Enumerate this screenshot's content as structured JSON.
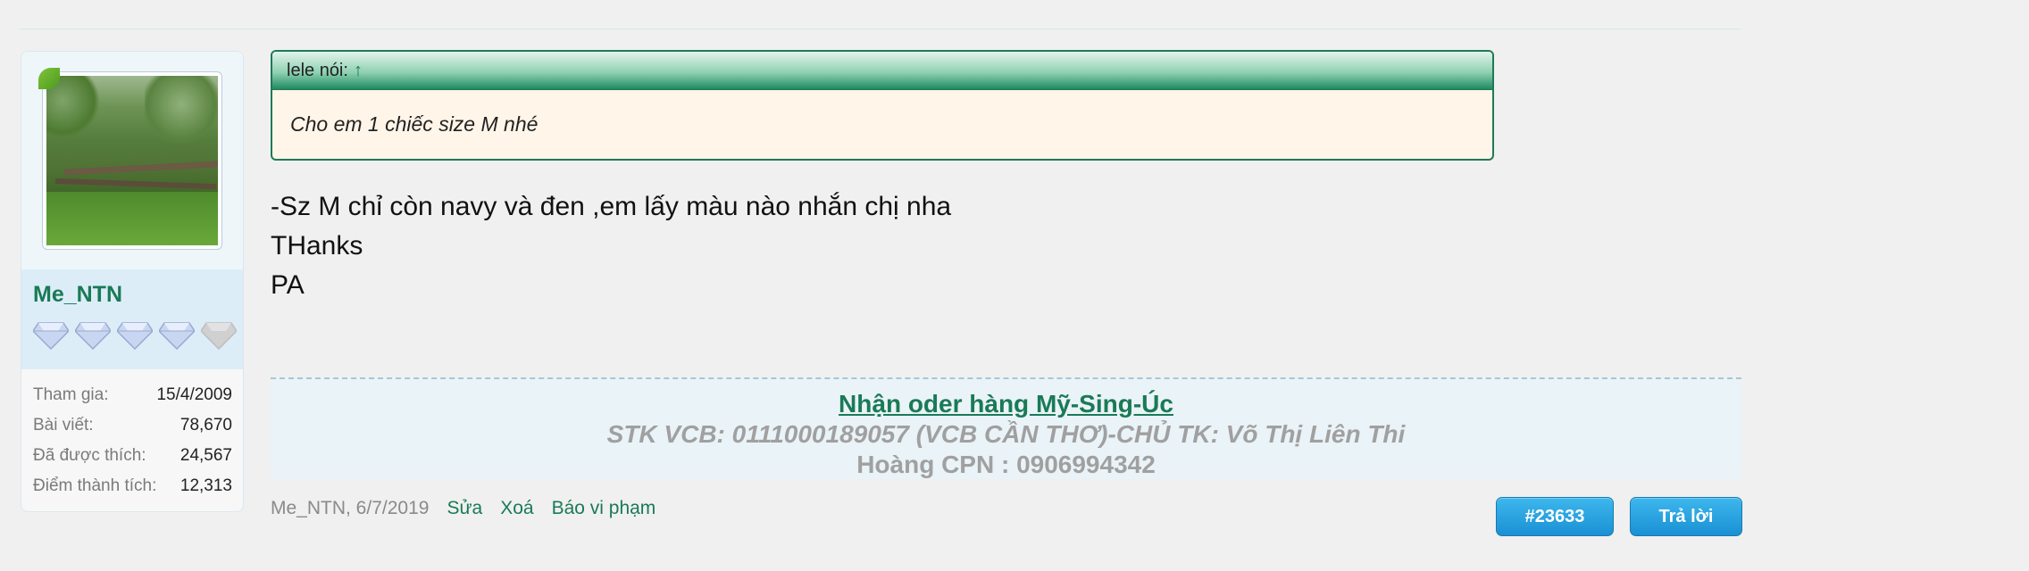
{
  "user": {
    "name": "Me_NTN",
    "rank_gems": {
      "filled": 4,
      "total": 5
    },
    "stats": [
      {
        "label": "Tham gia:",
        "value": "15/4/2009"
      },
      {
        "label": "Bài viết:",
        "value": "78,670"
      },
      {
        "label": "Đã được thích:",
        "value": "24,567"
      },
      {
        "label": "Điểm thành tích:",
        "value": "12,313"
      }
    ]
  },
  "quote": {
    "author_label": "lele nói:",
    "arrow": "↑",
    "text": "Cho em 1 chiếc size M nhé"
  },
  "message": {
    "lines": [
      "-Sz M chỉ còn navy và đen ,em lấy màu nào nhắn chị nha",
      "THanks",
      "PA"
    ]
  },
  "signature": {
    "line1": "Nhận oder hàng Mỹ-Sing-Úc",
    "line2": "STK VCB: 0111000189057 (VCB CẦN THƠ)-CHỦ TK: Võ Thị Liên Thi",
    "line3": "Hoàng CPN : 0906994342"
  },
  "meta": {
    "author_date": "Me_NTN, 6/7/2019",
    "edit": "Sửa",
    "delete": "Xoá",
    "report": "Báo vi phạm"
  },
  "buttons": {
    "post_number": "#23633",
    "reply": "Trả lời"
  },
  "colors": {
    "accent_green": "#1a7a56",
    "button_blue": "#1a90d3",
    "quote_bg": "#fff5e8"
  }
}
